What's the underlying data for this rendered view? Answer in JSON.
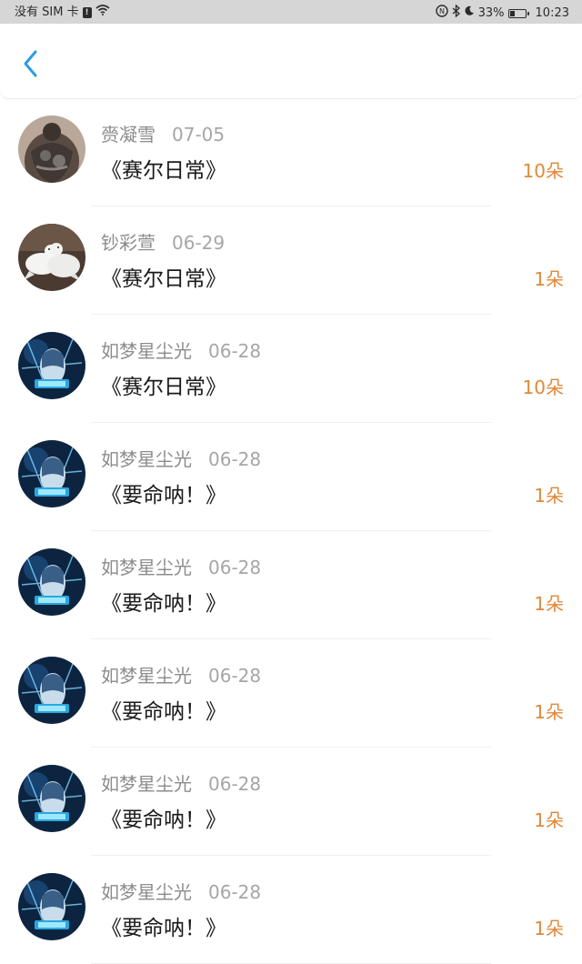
{
  "status_bar": {
    "carrier": "没有 SIM 卡",
    "battery": "33%",
    "battery_level": 0.33,
    "time": "10:23"
  },
  "header": {
    "back_icon": "chevron-left-icon",
    "accent_color": "#2d9be6"
  },
  "colors": {
    "amount": "#e0883a",
    "name": "#8c8c8c",
    "title": "#1a1a1a"
  },
  "items": [
    {
      "name": "赍凝雪",
      "date": "07-05",
      "title": "《赛尔日常》",
      "amount": "10朵",
      "avatar": "tattoo-avatar"
    },
    {
      "name": "钞彩萱",
      "date": "06-29",
      "title": "《赛尔日常》",
      "amount": "1朵",
      "avatar": "doves-avatar"
    },
    {
      "name": "如梦星尘光",
      "date": "06-28",
      "title": "《赛尔日常》",
      "amount": "10朵",
      "avatar": "anime-avatar"
    },
    {
      "name": "如梦星尘光",
      "date": "06-28",
      "title": "《要命呐！》",
      "amount": "1朵",
      "avatar": "anime-avatar"
    },
    {
      "name": "如梦星尘光",
      "date": "06-28",
      "title": "《要命呐！》",
      "amount": "1朵",
      "avatar": "anime-avatar"
    },
    {
      "name": "如梦星尘光",
      "date": "06-28",
      "title": "《要命呐！》",
      "amount": "1朵",
      "avatar": "anime-avatar"
    },
    {
      "name": "如梦星尘光",
      "date": "06-28",
      "title": "《要命呐！》",
      "amount": "1朵",
      "avatar": "anime-avatar"
    },
    {
      "name": "如梦星尘光",
      "date": "06-28",
      "title": "《要命呐！》",
      "amount": "1朵",
      "avatar": "anime-avatar"
    }
  ]
}
